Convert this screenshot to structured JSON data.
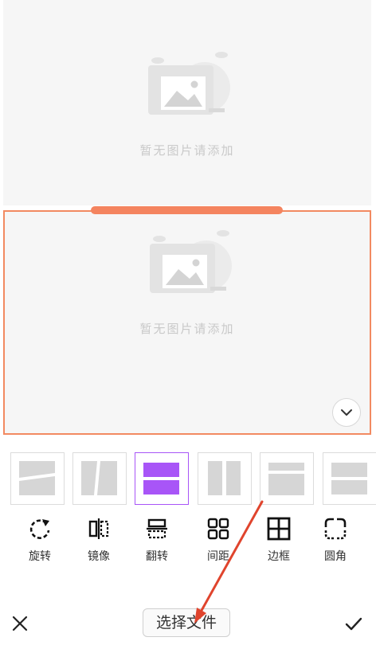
{
  "panels": {
    "top": {
      "placeholder_text": "暂无图片请添加"
    },
    "bottom": {
      "placeholder_text": "暂无图片请添加"
    }
  },
  "layout_options": [
    {
      "name": "slant-horizontal",
      "selected": false
    },
    {
      "name": "slant-vertical",
      "selected": false
    },
    {
      "name": "two-rows",
      "selected": true
    },
    {
      "name": "two-columns",
      "selected": false
    },
    {
      "name": "top-strip",
      "selected": false
    },
    {
      "name": "two-rows-wide",
      "selected": false
    }
  ],
  "tools": [
    {
      "label": "旋转",
      "icon": "rotate-icon"
    },
    {
      "label": "镜像",
      "icon": "mirror-icon"
    },
    {
      "label": "翻转",
      "icon": "flip-icon"
    },
    {
      "label": "间距",
      "icon": "spacing-icon"
    },
    {
      "label": "边框",
      "icon": "border-icon"
    },
    {
      "label": "圆角",
      "icon": "rounded-corner-icon"
    }
  ],
  "bottom_bar": {
    "choose_file_label": "选择文件",
    "cancel_icon": "close-icon",
    "confirm_icon": "check-icon"
  },
  "colors": {
    "accent_orange": "#f28a61",
    "selected_purple": "#a855f7",
    "annotation_red": "#e0442d"
  }
}
